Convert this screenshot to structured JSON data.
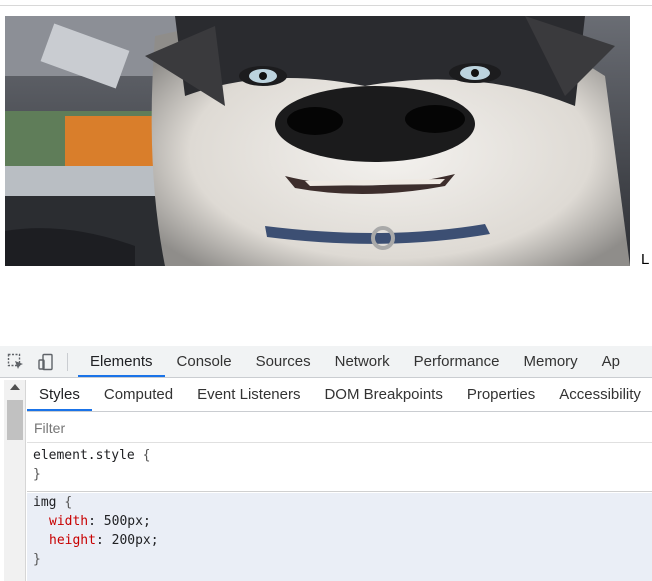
{
  "page": {
    "trailing_text": "L"
  },
  "photo": {
    "subject": "husky dog close-up in car",
    "icon": "dog-photo"
  },
  "devtools": {
    "toolbar_icons": [
      "inspect-element-icon",
      "device-toolbar-icon"
    ],
    "tabs": [
      {
        "label": "Elements",
        "active": true
      },
      {
        "label": "Console",
        "active": false
      },
      {
        "label": "Sources",
        "active": false
      },
      {
        "label": "Network",
        "active": false
      },
      {
        "label": "Performance",
        "active": false
      },
      {
        "label": "Memory",
        "active": false
      },
      {
        "label": "Ap",
        "active": false
      }
    ],
    "subtabs": [
      {
        "label": "Styles",
        "active": true
      },
      {
        "label": "Computed",
        "active": false
      },
      {
        "label": "Event Listeners",
        "active": false
      },
      {
        "label": "DOM Breakpoints",
        "active": false
      },
      {
        "label": "Properties",
        "active": false
      },
      {
        "label": "Accessibility",
        "active": false
      }
    ],
    "filter": {
      "placeholder": "Filter",
      "value": ""
    },
    "rules": [
      {
        "selector": "element.style",
        "open": "{",
        "close": "}",
        "properties": []
      },
      {
        "selector": "img",
        "open": "{",
        "close": "}",
        "properties": [
          {
            "name": "width",
            "value": "500px"
          },
          {
            "name": "height",
            "value": "200px"
          }
        ]
      }
    ],
    "colors": {
      "accent": "#1a73e8",
      "property": "#c80000",
      "rule_bg": "#eaeef6"
    }
  }
}
